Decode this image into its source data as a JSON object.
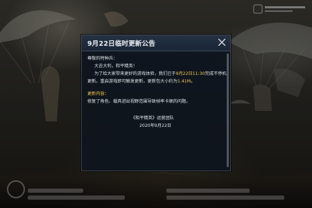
{
  "dialog": {
    "title": "9月22日临时更新公告",
    "close_icon": "close-icon",
    "greeting": "尊敬的特种兵：",
    "salutation": "大吉大利，和平精英！",
    "para1_before": "为了给大家带来更好的游戏体验，我们已于",
    "para1_time": "9月22日11:30",
    "para1_after": "完成不停机",
    "para2_before": "更新。重启游戏即可触发更新，更新包大小约为",
    "para2_size": "1.41M",
    "para2_after": "。",
    "section_title": "更新内容：",
    "section_item": "修复了角色、载具进出视野范围导致帧率卡顿的问题。",
    "signature": "《和平精英》运营团队",
    "date": "2020年9月22日",
    "scroll_fraction": 1.0
  },
  "colors": {
    "highlight": "#f2c94c",
    "dialog_bg": "#0e141e",
    "text": "#dfe3e8"
  }
}
